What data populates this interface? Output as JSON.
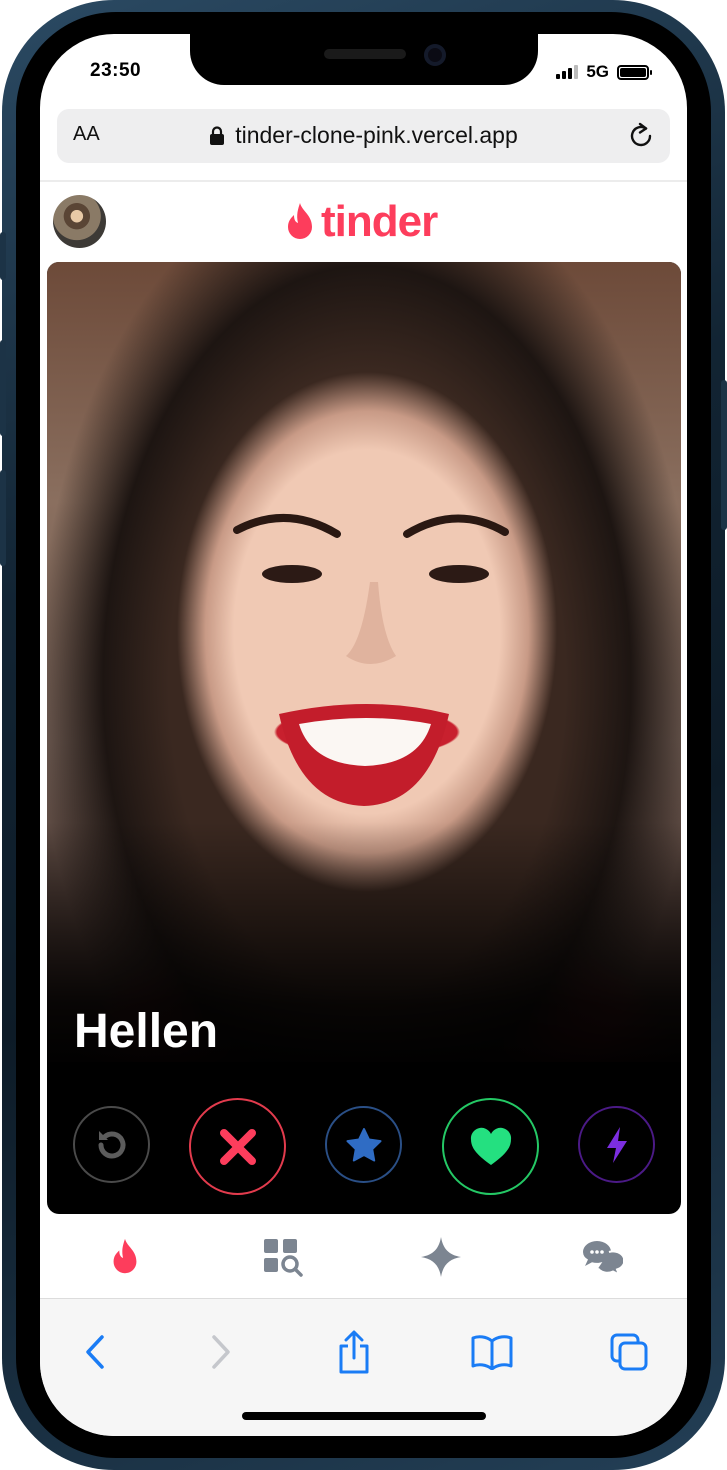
{
  "status_bar": {
    "time": "23:50",
    "network": "5G",
    "icons": [
      "signal-icon",
      "battery-icon"
    ]
  },
  "browser": {
    "text_size_label": "AA",
    "url": "tinder-clone-pink.vercel.app",
    "icons": [
      "lock-icon",
      "reload-icon"
    ]
  },
  "app_header": {
    "logo_text": "tinder",
    "logo_color": "#fd3d5c",
    "avatar_icon": "user-avatar"
  },
  "card": {
    "name": "Hellen",
    "actions": [
      {
        "name": "rewind",
        "icon": "rewind-icon",
        "color": "#4a4a4a"
      },
      {
        "name": "nope",
        "icon": "x-icon",
        "color": "#fd3d5c"
      },
      {
        "name": "super-like",
        "icon": "star-icon",
        "color": "#2f6cc4"
      },
      {
        "name": "like",
        "icon": "heart-icon",
        "color": "#24e080"
      },
      {
        "name": "boost",
        "icon": "lightning-icon",
        "color": "#7c2ee0"
      }
    ]
  },
  "bottom_nav": {
    "items": [
      {
        "name": "home",
        "icon": "flame-icon",
        "active": true
      },
      {
        "name": "explore",
        "icon": "explore-icon",
        "active": false
      },
      {
        "name": "top-picks",
        "icon": "sparkle-icon",
        "active": false
      },
      {
        "name": "messages",
        "icon": "chat-icon",
        "active": false
      }
    ],
    "active_color": "#fd3d5c",
    "inactive_color": "#7c8591"
  },
  "safari_toolbar": {
    "items": [
      "back-icon",
      "forward-icon",
      "share-icon",
      "bookmarks-icon",
      "tabs-icon"
    ],
    "accent_color": "#1a7cf5"
  }
}
